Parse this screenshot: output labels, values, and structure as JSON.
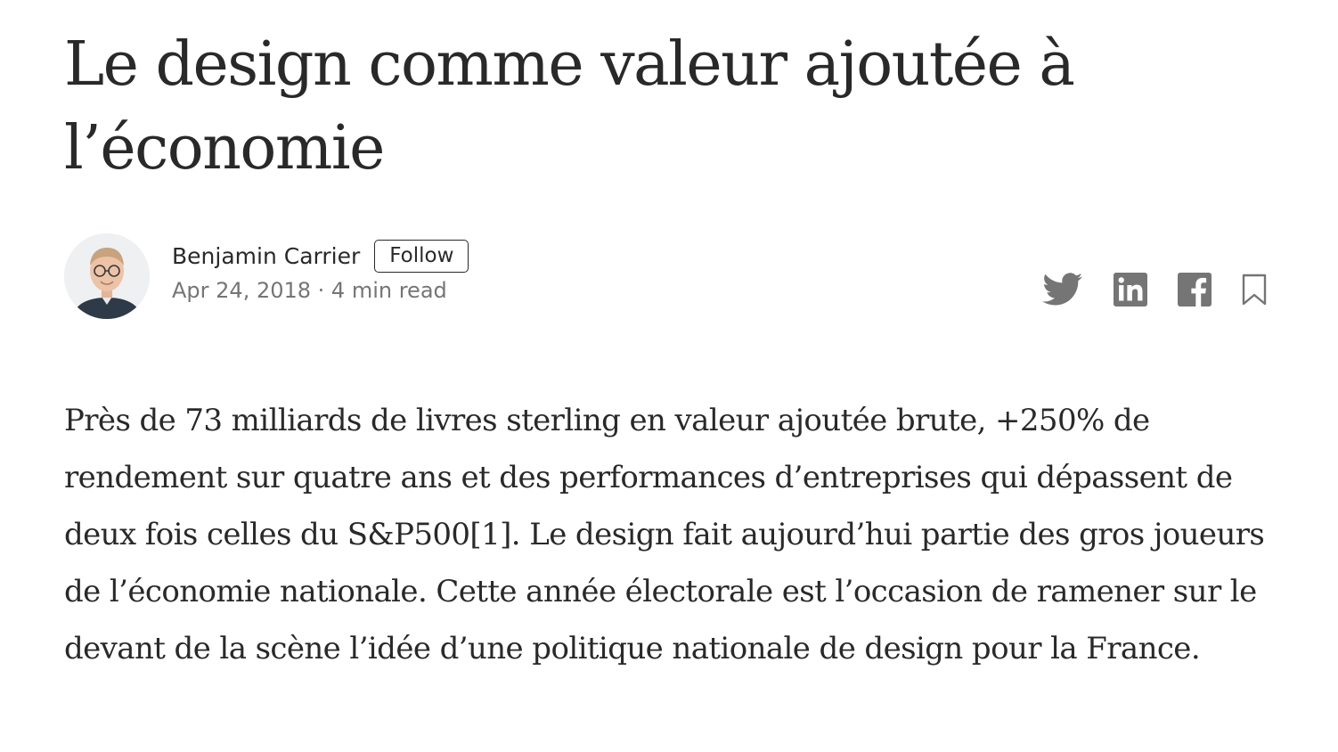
{
  "article": {
    "title": "Le design comme valeur ajoutée à l’économie",
    "author": {
      "name": "Benjamin Carrier",
      "follow_label": "Follow"
    },
    "meta": {
      "date": "Apr 24, 2018",
      "separator": " · ",
      "read_time": "4 min read"
    },
    "share": {
      "icons": [
        "twitter-icon",
        "linkedin-icon",
        "facebook-icon",
        "bookmark-icon"
      ],
      "icon_color": "#757575"
    },
    "body": "Près de 73 milliards de livres sterling en valeur ajoutée brute, +250% de rendement sur quatre ans et des performances d’entreprises qui dépassent de deux fois celles du S&P500[1]. Le design fait aujourd’hui partie des gros joueurs de l’économie nationale. Cette année électorale est l’occasion de ramener sur le devant de la scène l’idée d’une politique nationale de design pour la France."
  }
}
